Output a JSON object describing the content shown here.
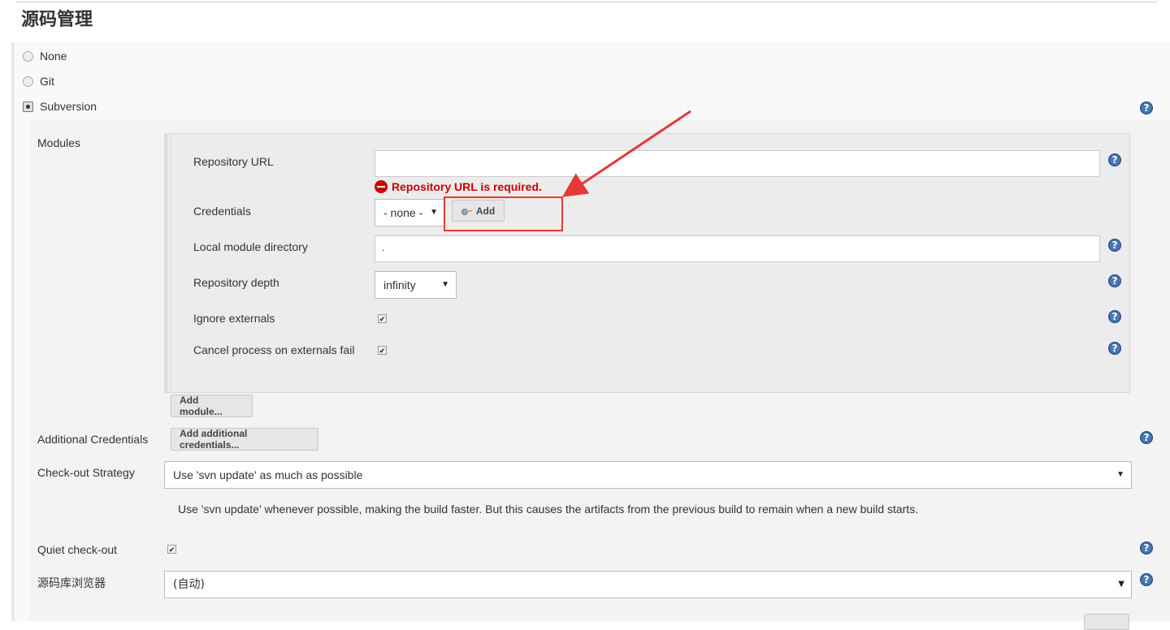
{
  "section": {
    "title": "源码管理"
  },
  "scm_options": {
    "none": "None",
    "git": "Git",
    "subversion": "Subversion",
    "selected": "Subversion"
  },
  "modules": {
    "label": "Modules",
    "repository_url_label": "Repository URL",
    "repository_url_value": "",
    "repository_url_error": "Repository URL is required.",
    "credentials_label": "Credentials",
    "credentials_value": "- none -",
    "add_button": "Add",
    "local_dir_label": "Local module directory",
    "local_dir_value": ".",
    "depth_label": "Repository depth",
    "depth_value": "infinity",
    "ignore_externals_label": "Ignore externals",
    "ignore_externals_checked": true,
    "cancel_externals_label": "Cancel process on externals fail",
    "cancel_externals_checked": true,
    "add_module_button": "Add module..."
  },
  "additional_credentials": {
    "label": "Additional Credentials",
    "button": "Add additional credentials..."
  },
  "checkout_strategy": {
    "label": "Check-out Strategy",
    "value": "Use 'svn update' as much as possible",
    "description": "Use 'svn update' whenever possible, making the build faster. But this causes the artifacts from the previous build to remain when a new build starts."
  },
  "quiet_checkout": {
    "label": "Quiet check-out",
    "checked": true
  },
  "repo_browser": {
    "label": "源码库浏览器",
    "value": "(自动)"
  },
  "help_glyph": "?",
  "colors": {
    "error": "#cc0000",
    "help": "#4a78b6",
    "annotation": "#e53935"
  }
}
